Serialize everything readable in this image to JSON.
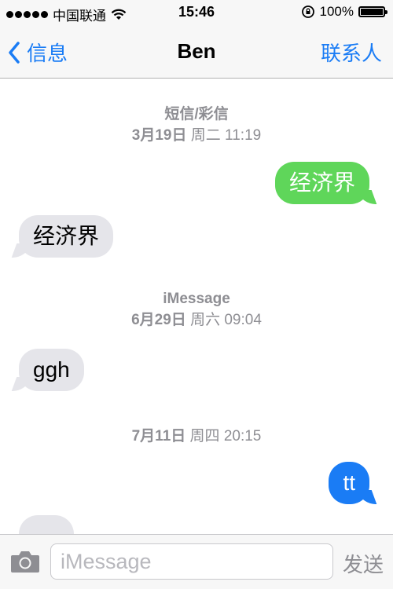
{
  "status_bar": {
    "carrier": "中国联通",
    "time": "15:46",
    "battery": "100%",
    "battery_level": 1.0
  },
  "nav": {
    "back_label": "信息",
    "title": "Ben",
    "contact_label": "联系人"
  },
  "timestamps": [
    {
      "service": "短信/彩信",
      "date": "3月19日",
      "time": "周二 11:19"
    },
    {
      "service": "iMessage",
      "date": "6月29日",
      "time": "周六 09:04"
    },
    {
      "service": "",
      "date": "7月11日",
      "time": "周四 20:15"
    }
  ],
  "messages": [
    {
      "text": "经济界",
      "direction": "outgoing",
      "type": "sms"
    },
    {
      "text": "经济界",
      "direction": "incoming",
      "type": "sms"
    },
    {
      "text": "ggh",
      "direction": "incoming",
      "type": "imessage"
    },
    {
      "text": "tt",
      "direction": "outgoing",
      "type": "imessage"
    },
    {
      "text": "",
      "direction": "incoming",
      "type": "imessage"
    }
  ],
  "input": {
    "placeholder": "iMessage",
    "value": "",
    "send_label": "发送"
  },
  "colors": {
    "accent": "#1a7cf5",
    "sms_bubble": "#5fd65a",
    "imessage_bubble": "#1a7cf5",
    "incoming_bubble": "#e5e5ea",
    "timestamp": "#8e8e93"
  }
}
